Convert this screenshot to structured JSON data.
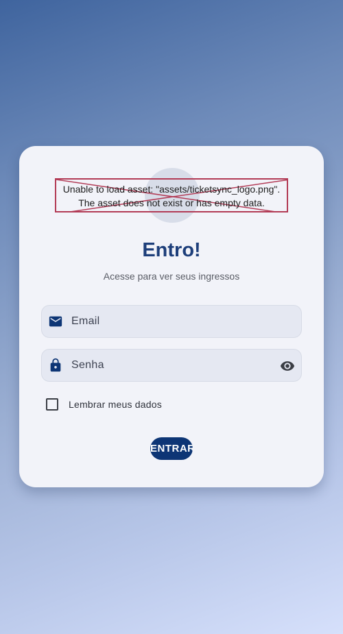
{
  "login": {
    "logo_error_line1": "Unable to load asset: \"assets/ticketsync_logo.png\".",
    "logo_error_line2": "The asset does not exist or has empty data.",
    "title": "Entro!",
    "subtitle": "Acesse para ver seus ingressos",
    "email_placeholder": "Email",
    "password_placeholder": "Senha",
    "remember_label": "Lembrar meus dados",
    "remember_checked": false,
    "submit_label": "ENTRAR"
  },
  "icons": {
    "email": "mail-icon",
    "password": "lock-icon",
    "visibility": "eye-icon"
  },
  "colors": {
    "primary": "#0d3575",
    "title": "#1d3e7a",
    "card": "#f2f3f9",
    "field": "#e5e8f2",
    "error_border": "#b23a55"
  }
}
